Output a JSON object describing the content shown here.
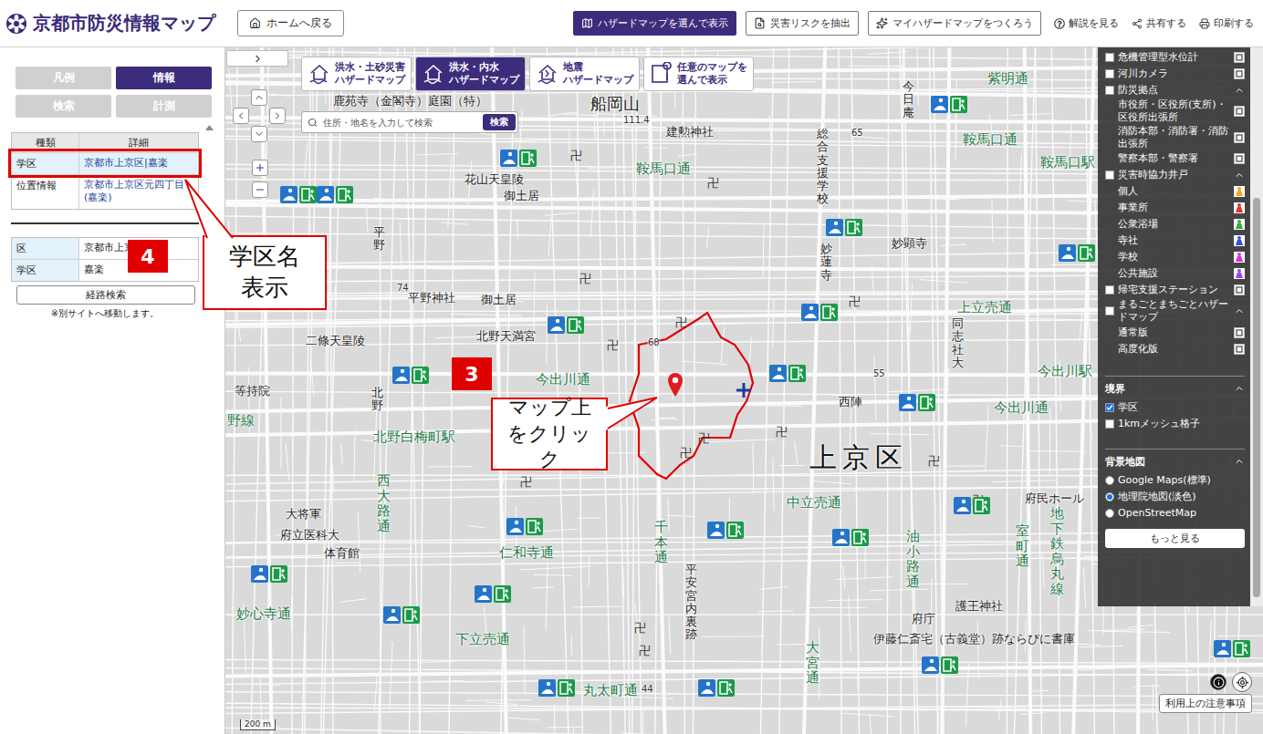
{
  "header": {
    "title": "京都市防災情報マップ",
    "home_button": "ホームへ戻る",
    "actions": [
      {
        "label": "ハザードマップを選んで表示",
        "primary": true
      },
      {
        "label": "災害リスクを抽出",
        "primary": false
      },
      {
        "label": "マイハザードマップをつくろう",
        "primary": false
      }
    ],
    "links": [
      "解説を見る",
      "共有する",
      "印刷する"
    ]
  },
  "left_panel": {
    "tabs": [
      {
        "label": "凡例",
        "selected": false
      },
      {
        "label": "情報",
        "selected": true
      },
      {
        "label": "検索",
        "selected": false
      },
      {
        "label": "計測",
        "selected": false
      }
    ],
    "info_table": {
      "columns": [
        "種類",
        "詳細"
      ],
      "rows": [
        {
          "type": "学区",
          "detail": "京都市上京区|嘉楽",
          "highlighted": true
        },
        {
          "type": "位置情報",
          "detail": "京都市上京区元四丁目(嘉楽)",
          "highlighted": false
        }
      ]
    },
    "area_table": {
      "rows": [
        {
          "type": "区",
          "detail": "京都市上京区"
        },
        {
          "type": "学区",
          "detail": "嘉楽"
        }
      ]
    },
    "route_button": "経路検索",
    "note": "※別サイトへ移動します。"
  },
  "map": {
    "map_tabs": [
      {
        "lines": [
          "洪水・土砂災害",
          "ハザードマップ"
        ],
        "selected": false
      },
      {
        "lines": [
          "洪水・内水",
          "ハザードマップ"
        ],
        "selected": true
      },
      {
        "lines": [
          "地震",
          "ハザードマップ"
        ],
        "selected": false
      },
      {
        "lines": [
          "任意のマップを",
          "選んで表示"
        ],
        "selected": false
      }
    ],
    "search": {
      "placeholder": "住所・地名を入力して検索",
      "button": "検索"
    },
    "labels": [
      {
        "text": "鹿苑寺（金閣寺）庭園（特）",
        "kind": "place"
      },
      {
        "text": "船岡山",
        "kind": "landmark"
      },
      {
        "text": "建勲神社",
        "kind": "place"
      },
      {
        "text": "鞍馬口通",
        "kind": "street"
      },
      {
        "text": "鞍馬口通",
        "kind": "street"
      },
      {
        "text": "鞍馬口駅",
        "kind": "street"
      },
      {
        "text": "紫明通",
        "kind": "street"
      },
      {
        "text": "花山天皇陵",
        "kind": "place"
      },
      {
        "text": "御土居",
        "kind": "place"
      },
      {
        "text": "御土居",
        "kind": "place"
      },
      {
        "text": "平野",
        "kind": "place-vertical"
      },
      {
        "text": "平野神社",
        "kind": "place"
      },
      {
        "text": "北野天満宮",
        "kind": "place"
      },
      {
        "text": "二條天皇陵",
        "kind": "place"
      },
      {
        "text": "等持院",
        "kind": "place"
      },
      {
        "text": "北野",
        "kind": "place-vertical"
      },
      {
        "text": "北野白梅町駅",
        "kind": "street"
      },
      {
        "text": "今出川通",
        "kind": "street"
      },
      {
        "text": "今出川通",
        "kind": "street"
      },
      {
        "text": "上京区",
        "kind": "ward"
      },
      {
        "text": "西大路通",
        "kind": "street-vertical"
      },
      {
        "text": "大将軍",
        "kind": "place"
      },
      {
        "text": "府立医科大",
        "kind": "place"
      },
      {
        "text": "体育館",
        "kind": "place"
      },
      {
        "text": "仁和寺通",
        "kind": "street"
      },
      {
        "text": "千本通",
        "kind": "street-vertical"
      },
      {
        "text": "平安宮内裏跡",
        "kind": "place-vertical"
      },
      {
        "text": "中立売通",
        "kind": "street"
      },
      {
        "text": "油小路通",
        "kind": "street-vertical"
      },
      {
        "text": "府民ホール",
        "kind": "place"
      },
      {
        "text": "室町通",
        "kind": "street-vertical"
      },
      {
        "text": "地下鉄烏丸線",
        "kind": "street-vertical"
      },
      {
        "text": "大宮通",
        "kind": "street-vertical"
      },
      {
        "text": "府庁",
        "kind": "place"
      },
      {
        "text": "護王神社",
        "kind": "place"
      },
      {
        "text": "伊藤仁斎宅（古義堂）跡ならびに書庫",
        "kind": "place"
      },
      {
        "text": "下立売通",
        "kind": "street"
      },
      {
        "text": "丸太町通",
        "kind": "street"
      },
      {
        "text": "妙心寺通",
        "kind": "street"
      },
      {
        "text": "上立売通",
        "kind": "street"
      },
      {
        "text": "今出川駅",
        "kind": "street"
      },
      {
        "text": "同志社大",
        "kind": "place-vertical"
      },
      {
        "text": "今日庵",
        "kind": "place-vertical"
      },
      {
        "text": "総合支援学校",
        "kind": "place-vertical"
      },
      {
        "text": "妙蓮寺",
        "kind": "place-vertical"
      },
      {
        "text": "妙顕寺",
        "kind": "place"
      },
      {
        "text": "西陣",
        "kind": "place"
      },
      {
        "text": "野線",
        "kind": "street"
      },
      {
        "text": "111.4",
        "kind": "elevation"
      },
      {
        "text": "65",
        "kind": "elevation"
      },
      {
        "text": "74",
        "kind": "elevation"
      },
      {
        "text": "68",
        "kind": "elevation"
      },
      {
        "text": "55",
        "kind": "elevation"
      },
      {
        "text": "44",
        "kind": "elevation"
      }
    ],
    "temple_marks": [
      "卍",
      "卍",
      "卍",
      "卍",
      "卍",
      "卍",
      "卍",
      "卍",
      "卍",
      "卍",
      "卍",
      "卍",
      "卍",
      "卍"
    ],
    "scale": "200 m",
    "notice_button": "利用上の注意事項"
  },
  "layers": {
    "items": [
      {
        "label": "危機管理型水位計",
        "kind": "check",
        "checked": false
      },
      {
        "label": "河川カメラ",
        "kind": "check",
        "checked": false
      },
      {
        "label": "防災拠点",
        "kind": "group",
        "checked": false
      },
      {
        "label": "市役所・区役所(支所)・区役所出張所",
        "kind": "sub"
      },
      {
        "label": "消防本部・消防署・消防出張所",
        "kind": "sub"
      },
      {
        "label": "警察本部・警察署",
        "kind": "sub"
      },
      {
        "label": "災害時協力井戸",
        "kind": "group",
        "checked": false
      },
      {
        "label": "個人",
        "kind": "sub",
        "color": "#f2a516"
      },
      {
        "label": "事業所",
        "kind": "sub",
        "color": "#e23232"
      },
      {
        "label": "公衆浴場",
        "kind": "sub",
        "color": "#2fae3a"
      },
      {
        "label": "寺社",
        "kind": "sub",
        "color": "#2f4fe0"
      },
      {
        "label": "学校",
        "kind": "sub",
        "color": "#e02fd6"
      },
      {
        "label": "公共施設",
        "kind": "sub",
        "color": "#9a45e8"
      },
      {
        "label": "帰宅支援ステーション",
        "kind": "check",
        "checked": false
      },
      {
        "label": "まるごとまちごとハザードマップ",
        "kind": "group",
        "checked": false
      },
      {
        "label": "通常版",
        "kind": "sub"
      },
      {
        "label": "高度化版",
        "kind": "sub"
      }
    ],
    "boundary": {
      "title": "境界",
      "items": [
        {
          "label": "学区",
          "checked": true
        },
        {
          "label": "1kmメッシュ格子",
          "checked": false
        }
      ]
    },
    "basemap": {
      "title": "背景地図",
      "options": [
        {
          "label": "Google Maps(標準)",
          "selected": false
        },
        {
          "label": "地理院地図(淡色)",
          "selected": true
        },
        {
          "label": "OpenStreetMap",
          "selected": false
        }
      ]
    },
    "more_button": "もっと見る"
  },
  "annotations": [
    {
      "number": "3",
      "text": "マップ上をクリック"
    },
    {
      "number": "4",
      "text": "学区名表示"
    }
  ]
}
